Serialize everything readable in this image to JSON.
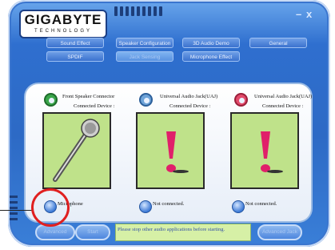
{
  "logo": {
    "main": "GIGABYTE",
    "sub": "TECHNOLOGY"
  },
  "window_controls": {
    "minimize": "–",
    "close": "x"
  },
  "tabs_row1": [
    "Sound Effect",
    "Speaker Configuration",
    "3D Audio Demo",
    "General"
  ],
  "tabs_row2": [
    "SPDIF",
    "Jack Sensing",
    "Microphone Effect"
  ],
  "active_tab": "Jack Sensing",
  "jacks": [
    {
      "label": "Front Speaker Connector",
      "connected": "Connected Device :",
      "status": "Microphone",
      "jack_color": "#3aa64a",
      "icon": "microphone-icon"
    },
    {
      "label": "Universal Audio Jack(UAJ)",
      "connected": "Connected Device :",
      "status": "Not connected.",
      "jack_color": "#6ea3d8",
      "icon": "exclamation-icon"
    },
    {
      "label": "Universal Audio Jack(UAJ)",
      "connected": "Connected Device :",
      "status": "Not connected.",
      "jack_color": "#e24a6a",
      "icon": "exclamation-icon"
    }
  ],
  "footer": {
    "button1": "Advanced",
    "button2": "Start",
    "message": "Please stop other audio applications before starting.",
    "button3": "Advanced Jack"
  },
  "colors": {
    "accent": "#2f6fcf",
    "device_bg": "#bfe28a",
    "alert": "#e0206a",
    "highlight_ring": "#e02020"
  }
}
